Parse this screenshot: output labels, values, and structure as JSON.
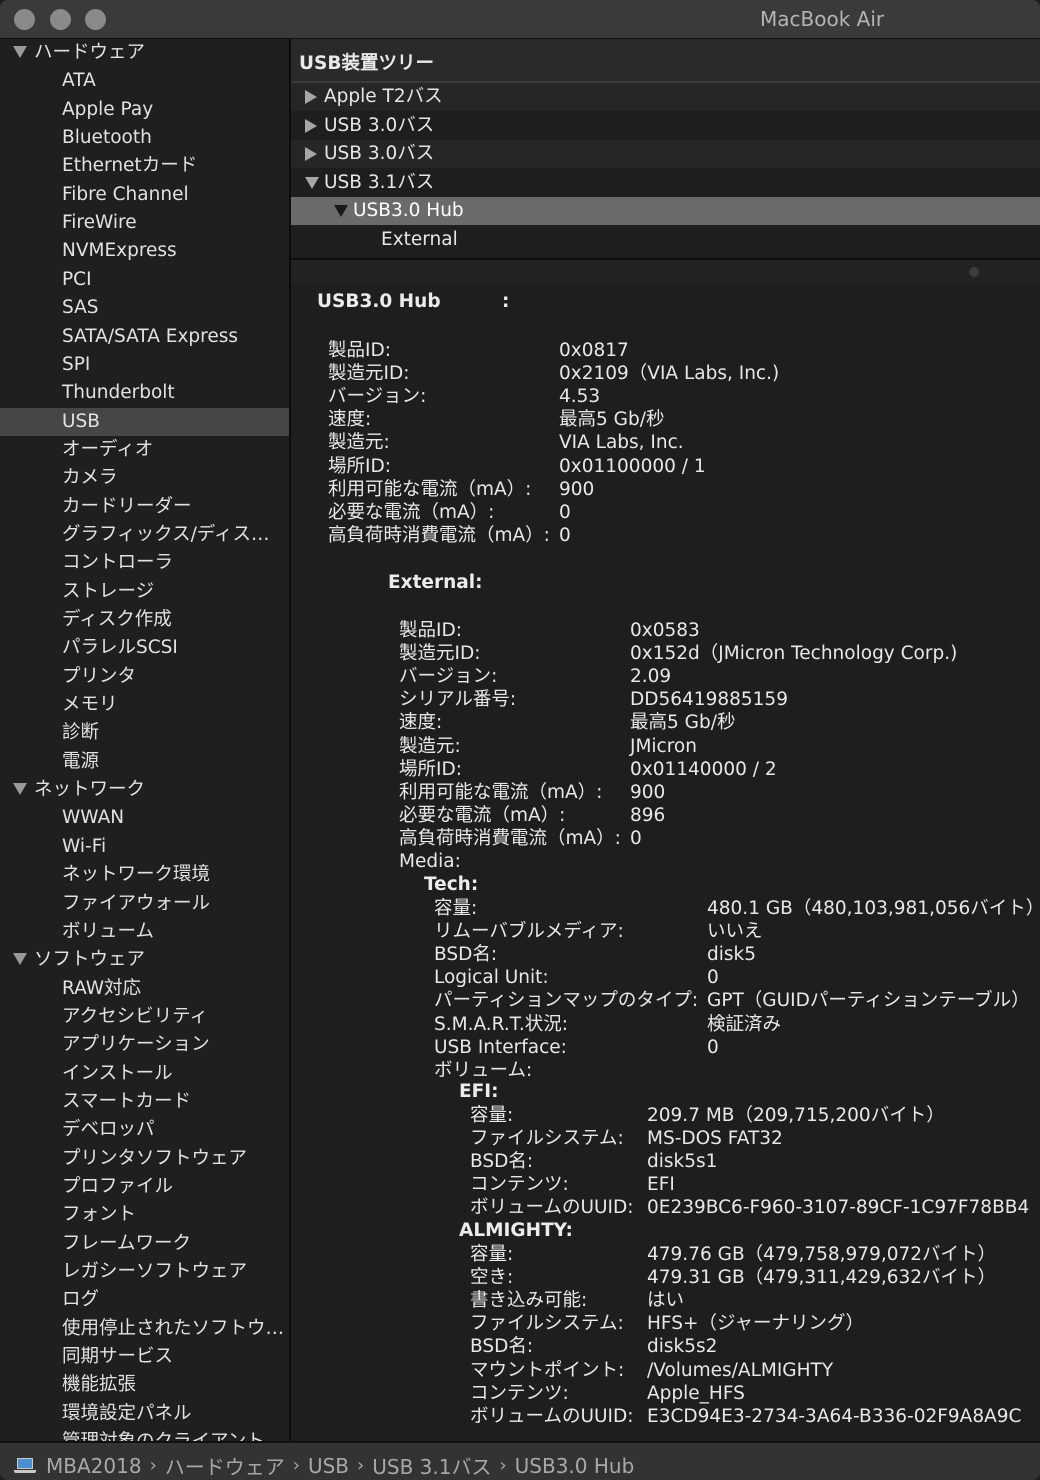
{
  "window": {
    "title": "MacBook Air",
    "traffic_lights": [
      "close",
      "minimize",
      "zoom"
    ]
  },
  "sidebar": {
    "selected": "USB",
    "groups": [
      {
        "label": "ハードウェア",
        "expanded": true,
        "items": [
          "ATA",
          "Apple Pay",
          "Bluetooth",
          "Ethernetカード",
          "Fibre Channel",
          "FireWire",
          "NVMExpress",
          "PCI",
          "SAS",
          "SATA/SATA Express",
          "SPI",
          "Thunderbolt",
          "USB",
          "オーディオ",
          "カメラ",
          "カードリーダー",
          "グラフィックス/ディス…",
          "コントローラ",
          "ストレージ",
          "ディスク作成",
          "パラレルSCSI",
          "プリンタ",
          "メモリ",
          "診断",
          "電源"
        ]
      },
      {
        "label": "ネットワーク",
        "expanded": true,
        "items": [
          "WWAN",
          "Wi-Fi",
          "ネットワーク環境",
          "ファイアウォール",
          "ボリューム"
        ]
      },
      {
        "label": "ソフトウェア",
        "expanded": true,
        "items": [
          "RAW対応",
          "アクセシビリティ",
          "アプリケーション",
          "インストール",
          "スマートカード",
          "デベロッパ",
          "プリンタソフトウェア",
          "プロファイル",
          "フォント",
          "フレームワーク",
          "レガシーソフトウェア",
          "ログ",
          "使用停止されたソフトウ…",
          "同期サービス",
          "機能拡張",
          "環境設定パネル",
          "管理対象のクライアント"
        ]
      }
    ]
  },
  "tree": {
    "header": "USB装置ツリー",
    "rows": [
      {
        "label": "Apple T2バス",
        "level": 0,
        "state": "collapsed"
      },
      {
        "label": "USB 3.0バス",
        "level": 0,
        "state": "collapsed"
      },
      {
        "label": "USB 3.0バス",
        "level": 0,
        "state": "collapsed"
      },
      {
        "label": "USB 3.1バス",
        "level": 0,
        "state": "expanded"
      },
      {
        "label": "USB3.0 Hub",
        "level": 1,
        "state": "expanded",
        "selected": true
      },
      {
        "label": "External",
        "level": 2,
        "state": "leaf"
      }
    ]
  },
  "detail": {
    "hub_title": "USB3.0 Hub",
    "hub_colon": ":",
    "hub": [
      {
        "k": "製品ID:",
        "v": "0x0817"
      },
      {
        "k": "製造元ID:",
        "v": "0x2109（VIA Labs, Inc.)"
      },
      {
        "k": "バージョン:",
        "v": "4.53"
      },
      {
        "k": "速度:",
        "v": "最高5 Gb/秒"
      },
      {
        "k": "製造元:",
        "v": "VIA Labs, Inc."
      },
      {
        "k": "場所ID:",
        "v": "0x01100000 / 1"
      },
      {
        "k": "利用可能な電流（mA）:",
        "v": "900"
      },
      {
        "k": "必要な電流（mA）:",
        "v": "0"
      },
      {
        "k": "高負荷時消費電流（mA）:",
        "v": "0"
      }
    ],
    "external_title": "External:",
    "external": [
      {
        "k": "製品ID:",
        "v": "0x0583"
      },
      {
        "k": "製造元ID:",
        "v": "0x152d（JMicron Technology Corp.)"
      },
      {
        "k": "バージョン:",
        "v": "2.09"
      },
      {
        "k": "シリアル番号:",
        "v": "DD56419885159"
      },
      {
        "k": "速度:",
        "v": "最高5 Gb/秒"
      },
      {
        "k": "製造元:",
        "v": "JMicron"
      },
      {
        "k": "場所ID:",
        "v": "0x01140000 / 2"
      },
      {
        "k": "利用可能な電流（mA）:",
        "v": "900"
      },
      {
        "k": "必要な電流（mA）:",
        "v": "896"
      },
      {
        "k": "高負荷時消費電流（mA）:",
        "v": "0"
      },
      {
        "k": "Media:",
        "v": ""
      }
    ],
    "tech_title": "Tech:",
    "tech": [
      {
        "k": "容量:",
        "v": "480.1 GB（480,103,981,056バイト）"
      },
      {
        "k": "リムーバブルメディア:",
        "v": "いいえ"
      },
      {
        "k": "BSD名:",
        "v": "disk5"
      },
      {
        "k": "Logical Unit:",
        "v": "0"
      },
      {
        "k": "パーティションマップのタイプ:",
        "v": "GPT（GUIDパーティションテーブル）"
      },
      {
        "k": "S.M.A.R.T.状況:",
        "v": "検証済み"
      },
      {
        "k": "USB Interface:",
        "v": "0"
      },
      {
        "k": "ボリューム:",
        "v": ""
      }
    ],
    "efi_title": "EFI:",
    "efi": [
      {
        "k": "容量:",
        "v": "209.7 MB（209,715,200バイト）"
      },
      {
        "k": "ファイルシステム:",
        "v": "MS-DOS FAT32"
      },
      {
        "k": "BSD名:",
        "v": "disk5s1"
      },
      {
        "k": "コンテンツ:",
        "v": "EFI"
      },
      {
        "k": "ボリュームのUUID:",
        "v": "0E239BC6-F960-3107-89CF-1C97F78BB4"
      }
    ],
    "almighty_title": "ALMIGHTY:",
    "almighty": [
      {
        "k": "容量:",
        "v": "479.76 GB（479,758,979,072バイト）"
      },
      {
        "k": "空き:",
        "v": "479.31 GB（479,311,429,632バイト）"
      },
      {
        "k": "書き込み可能:",
        "v": "はい"
      },
      {
        "k": "ファイルシステム:",
        "v": "HFS+（ジャーナリング）"
      },
      {
        "k": "BSD名:",
        "v": "disk5s2"
      },
      {
        "k": "マウントポイント:",
        "v": "/Volumes/ALMIGHTY"
      },
      {
        "k": "コンテンツ:",
        "v": "Apple_HFS"
      },
      {
        "k": "ボリュームのUUID:",
        "v": "E3CD94E3-2734-3A64-B336-02F9A8A9C"
      }
    ]
  },
  "breadcrumb": {
    "icon": "laptop-icon",
    "items": [
      "MBA2018",
      "ハードウェア",
      "USB",
      "USB 3.1バス",
      "USB3.0 Hub"
    ],
    "separator": "›"
  }
}
